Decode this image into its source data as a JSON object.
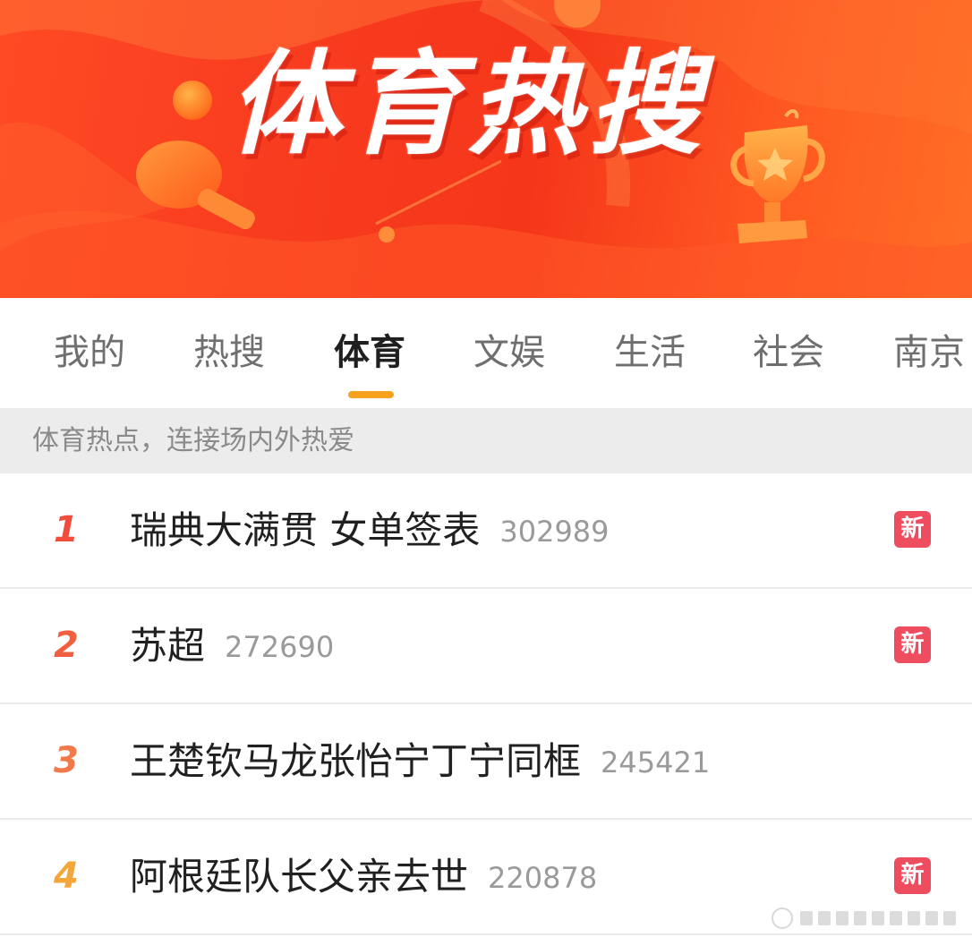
{
  "banner": {
    "title": "体育热搜",
    "colors": {
      "start": "#ff4a24",
      "mid": "#f5361a",
      "end": "#ff6e26"
    },
    "decor_icons": [
      "ping-pong-paddle-icon",
      "ball-icon",
      "trophy-icon",
      "star-icon"
    ]
  },
  "tabs": [
    {
      "label": "我的",
      "active": false
    },
    {
      "label": "热搜",
      "active": false
    },
    {
      "label": "体育",
      "active": true
    },
    {
      "label": "文娱",
      "active": false
    },
    {
      "label": "生活",
      "active": false
    },
    {
      "label": "社会",
      "active": false
    },
    {
      "label": "南京",
      "active": false
    }
  ],
  "tab_accent": "#f6a21d",
  "subtitle": "体育热点，连接场内外热爱",
  "items": [
    {
      "rank": "1",
      "title": "瑞典大满贯 女单签表",
      "count": "302989",
      "badge": "新"
    },
    {
      "rank": "2",
      "title": "苏超",
      "count": "272690",
      "badge": "新"
    },
    {
      "rank": "3",
      "title": "王楚钦马龙张怡宁丁宁同框",
      "count": "245421",
      "badge": ""
    },
    {
      "rank": "4",
      "title": "阿根廷队长父亲去世",
      "count": "220878",
      "badge": "新"
    }
  ],
  "badge_color": "#ee4d5f"
}
